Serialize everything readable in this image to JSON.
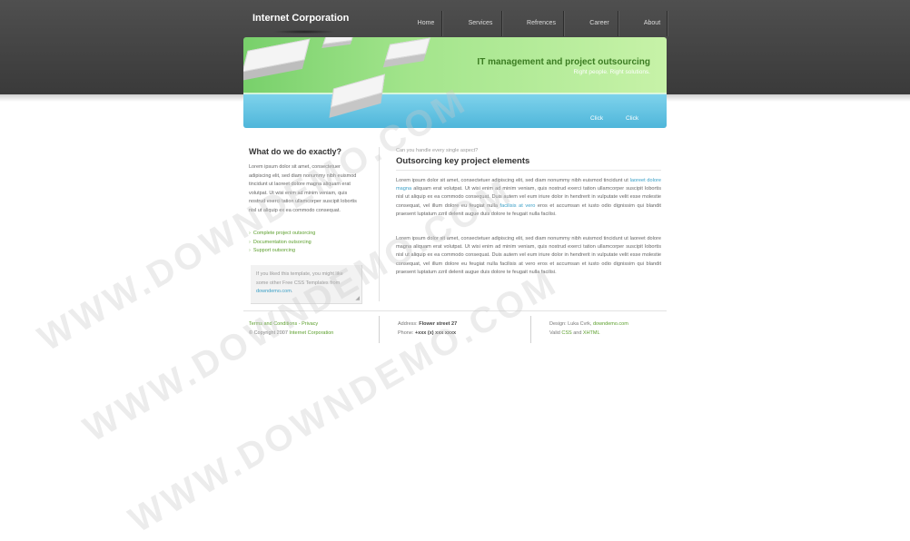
{
  "header": {
    "logo": "Internet Corporation",
    "nav": [
      "Home",
      "Services",
      "Refrences",
      "Career",
      "About"
    ]
  },
  "banner": {
    "title": "IT management and project outsourcing",
    "subtitle": "Right people. Right solutions.",
    "links": [
      "Click",
      "Click"
    ]
  },
  "sidebar": {
    "title": "What do we do exactly?",
    "text": "Lorem ipsum dolor sit amet, consectetuer adipiscing elit, sed diam nonummy nibh euismod tincidunt ut laoreet dolore magna aliquam erat volutpat. Ut wisi enim ad minim veniam, quis nostrud exerci tation ullamcorper suscipit lobortis nisl ut aliquip ex ea commodo consequat.",
    "items": [
      "Complete project outsorcing",
      "Documentation outsorcing",
      "Support outsorcing"
    ],
    "note": {
      "text": "If you liked this template, you might like some other Free CSS Templates from",
      "link": "downdemo.com",
      "end": "."
    }
  },
  "main": {
    "kicker": "Can you handle every single aspect?",
    "title": "Outsorcing key project elements",
    "p1": {
      "a": "Lorem ipsum dolor sit amet, consectetuer adipiscing elit, sed diam nonummy nibh euismod tincidunt ut",
      "link1": "laoreet dolore magna",
      "b": "aliquam erat volutpat. Ut wisi enim ad minim veniam, quis nostrud exerci tation ullamcorper suscipit lobortis nisl ut aliquip ex ea commodo consequat. Duis autem vel eum iriure dolor in hendrerit in vulputate velit esse molestie consequat, vel illum dolore eu feugiat nulla",
      "link2": "facilisis at vero",
      "c": "eros et accumsan et iusto odio dignissim qui blandit praesent luptatum zzril delenit augue duis dolore te feugait nulla facilisi."
    },
    "p2": "Lorem ipsum dolor sit amet, consectetuer adipiscing elit, sed diam nonummy nibh euismod tincidunt ut laoreet dolore magna aliquam erat volutpat. Ut wisi enim ad minim veniam, quis nostrud exerci tation ullamcorper suscipit lobortis nisl ut aliquip ex ea commodo consequat. Duis autem vel eum iriure dolor in hendrerit in vulputate velit esse molestie consequat, vel illum dolore eu feugiat nulla facilisis at vero eros et accumsan et iusto odio dignissim qui blandit praesent luptatum zzril delenit augue duis dolore te feugait nulla facilisi."
  },
  "footer": {
    "terms": "Terms and Conditions",
    "sep": " - ",
    "privacy": "Privacy",
    "copyright_prefix": "© Copyright 2007",
    "company": "Internet Corporation",
    "address_label": "Address:",
    "address": "Flower street 27",
    "phone_label": "Phone:",
    "phone": "+xxx (x) xxx xxxx",
    "design_prefix": "Design: Luka Cvrk,",
    "design_link": "downdemo.com",
    "valid_prefix": "Valid",
    "css": "CSS",
    "and": "and",
    "xhtml": "XHTML"
  },
  "watermark": "WWW.DOWNDEMO.COM"
}
